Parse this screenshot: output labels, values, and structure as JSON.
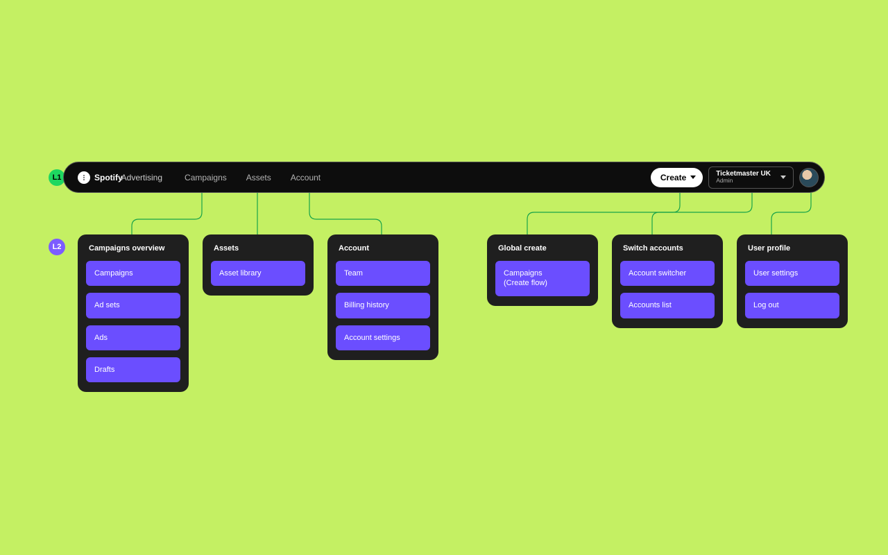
{
  "badges": {
    "l1": "L1",
    "l2": "L2"
  },
  "brand": {
    "bold": "Spotify",
    "sub": "Advertising"
  },
  "nav": {
    "campaigns": "Campaigns",
    "assets": "Assets",
    "account": "Account"
  },
  "create": {
    "label": "Create"
  },
  "account_switch": {
    "name": "Ticketmaster UK",
    "role": "Admin"
  },
  "panels": [
    {
      "title": "Campaigns overview",
      "items": [
        "Campaigns",
        "Ad sets",
        "Ads",
        "Drafts"
      ]
    },
    {
      "title": "Assets",
      "items": [
        "Asset library"
      ]
    },
    {
      "title": "Account",
      "items": [
        "Team",
        "Billing history",
        "Account settings"
      ]
    },
    {
      "title": "Global create",
      "items": [
        "Campaigns\n(Create flow)"
      ]
    },
    {
      "title": "Switch accounts",
      "items": [
        "Account switcher",
        "Accounts list"
      ]
    },
    {
      "title": "User profile",
      "items": [
        "User settings",
        "Log out"
      ]
    }
  ],
  "panel_gaps": [
    0,
    0,
    0,
    50,
    0,
    0
  ]
}
